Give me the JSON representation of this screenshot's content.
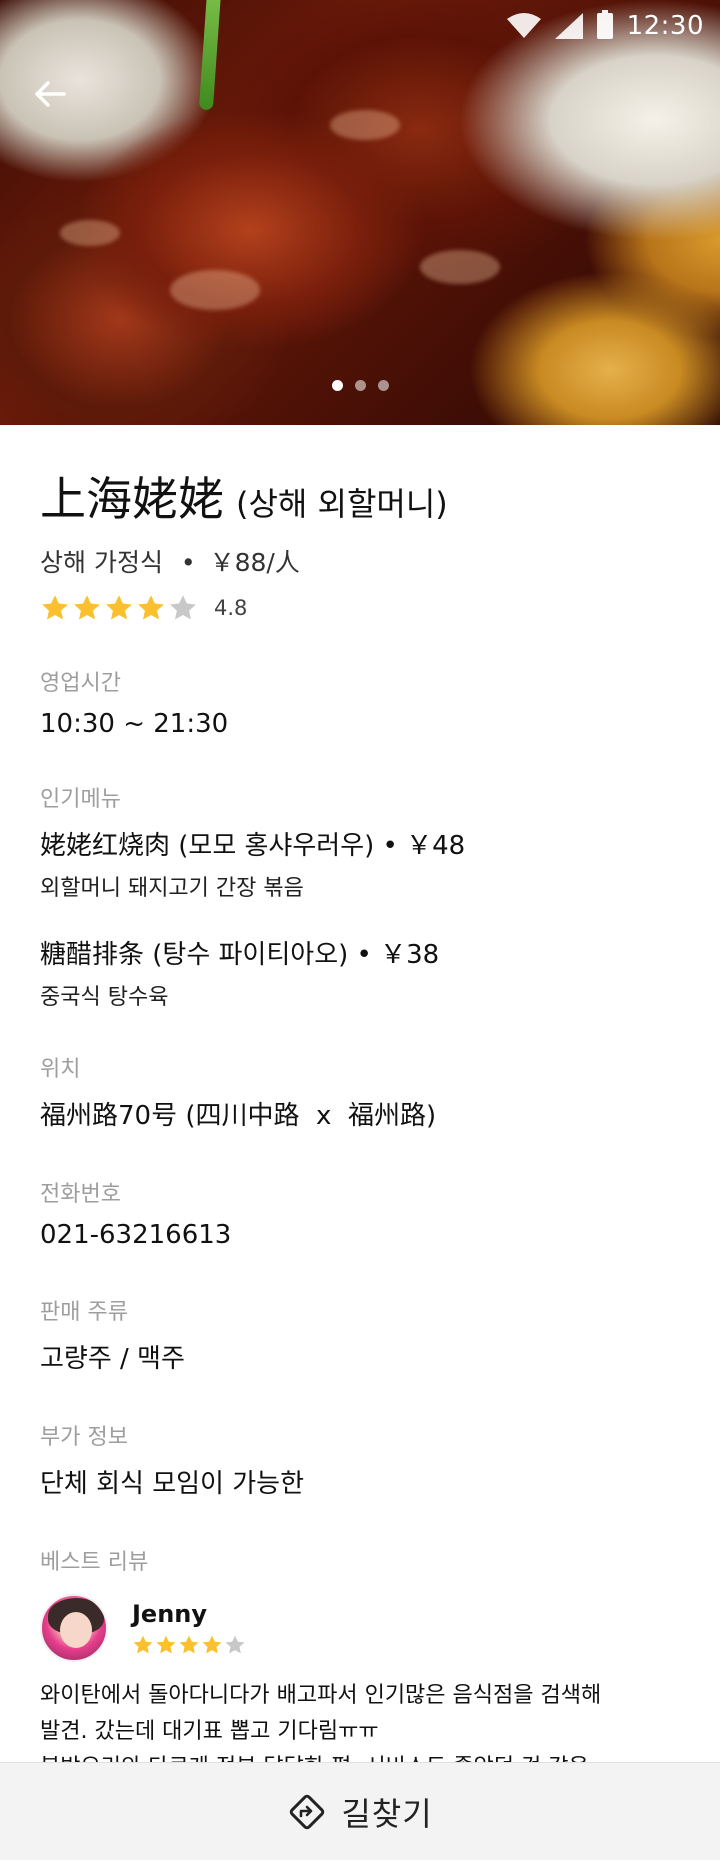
{
  "status_bar": {
    "time": "12:30"
  },
  "hero": {
    "page_count": 3,
    "active_page": 1
  },
  "restaurant": {
    "name": "上海姥姥",
    "name_translation": "(상해 외할머니)",
    "cuisine": "상해 가정식",
    "price": "￥88/人",
    "meta_separator": "•",
    "rating": 4.8,
    "rating_text": "4.8",
    "stars_filled": 4,
    "stars_total": 5
  },
  "sections": {
    "hours": {
      "label": "영업시간",
      "value": "10:30 ~ 21:30"
    },
    "popular_menu": {
      "label": "인기메뉴",
      "items": [
        {
          "name": "姥姥红烧肉 (모모 홍샤우러우) • ￥48",
          "desc": "외할머니 돼지고기 간장 볶음"
        },
        {
          "name": "糖醋排条 (탕수 파이티아오) • ￥38",
          "desc": "중국식 탕수육"
        }
      ]
    },
    "location": {
      "label": "위치",
      "value": "福州路70号 (四川中路  x  福州路)"
    },
    "phone": {
      "label": "전화번호",
      "value": "021-63216613"
    },
    "drinks": {
      "label": "판매 주류",
      "value": "고량주 / 맥주"
    },
    "extra": {
      "label": "부가 정보",
      "value": "단체 회식 모임이 가능한"
    },
    "review": {
      "label": "베스트 리뷰",
      "reviewer": "Jenny",
      "stars_filled": 4,
      "stars_total": 5,
      "lines": [
        "와이탄에서 돌아다니다가 배고파서 인기많은 음식점을 검색해",
        "발견. 갔는데 대기표 뽑고 기다림ㅠㅠ",
        "북방요리와 다르게 전부 달달한 편. 서비스도 좋았던 것 같음."
      ]
    }
  },
  "bottom_bar": {
    "directions_label": "길찾기"
  },
  "colors": {
    "star_filled": "#FBC02D",
    "star_empty": "#C8C8C8",
    "label_gray": "#9E9E9E",
    "bottom_bar_bg": "#F3F3F3"
  },
  "icons": [
    "back-arrow-icon",
    "wifi-icon",
    "signal-icon",
    "battery-icon",
    "star-icon",
    "directions-icon"
  ]
}
